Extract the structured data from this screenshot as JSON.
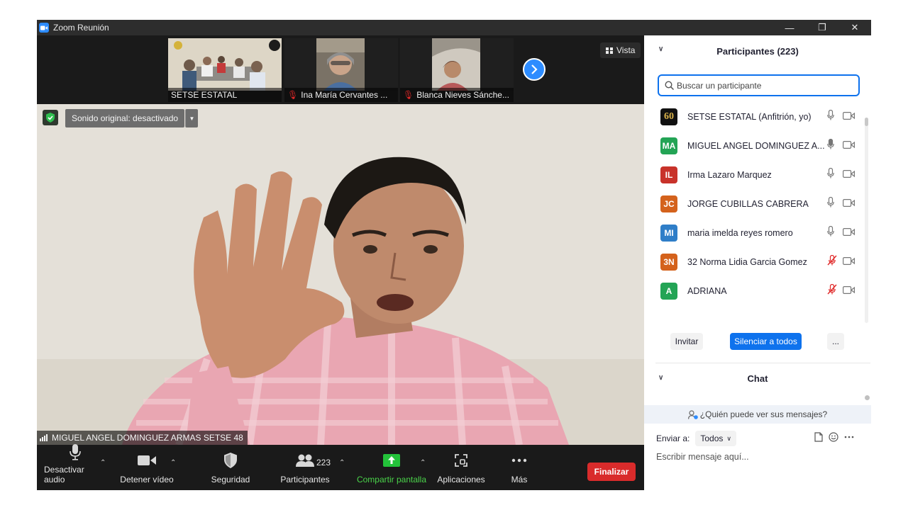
{
  "window": {
    "title": "Zoom Reunión"
  },
  "gallery": {
    "tiles": [
      {
        "name": "SETSE ESTATAL",
        "muted": false
      },
      {
        "name": "Ina María Cervantes ...",
        "muted": true
      },
      {
        "name": "Blanca Nieves Sánche...",
        "muted": true
      }
    ],
    "view_label": "Vista"
  },
  "main_video": {
    "sound_label": "Sonido original: desactivado",
    "speaker_name": "MIGUEL ANGEL DOMINGUEZ ARMAS  SETSE 48"
  },
  "toolbar": {
    "audio_label": "Desactivar audio",
    "video_label": "Detener vídeo",
    "security_label": "Seguridad",
    "participants_label": "Participantes",
    "participants_count": "223",
    "share_label": "Compartir pantalla",
    "apps_label": "Aplicaciones",
    "more_label": "Más",
    "end_label": "Finalizar"
  },
  "participants_panel": {
    "title": "Participantes (223)",
    "search_placeholder": "Buscar un participante",
    "items": [
      {
        "initials": "60",
        "name": "SETSE ESTATAL (Anfitrión, yo)",
        "color": "#1c1c1c",
        "muted": false
      },
      {
        "initials": "MA",
        "name": "MIGUEL ANGEL DOMINGUEZ A...",
        "color": "#23a455",
        "muted": false
      },
      {
        "initials": "IL",
        "name": "Irma Lazaro Marquez",
        "color": "#c8322a",
        "muted": false
      },
      {
        "initials": "JC",
        "name": "JORGE CUBILLAS CABRERA",
        "color": "#d4621c",
        "muted": false
      },
      {
        "initials": "MI",
        "name": "maria imelda reyes romero",
        "color": "#2f7ec8",
        "muted": false
      },
      {
        "initials": "3N",
        "name": "32 Norma Lidia Garcia Gomez",
        "color": "#d4621c",
        "muted": true
      },
      {
        "initials": "A",
        "name": "ADRIANA",
        "color": "#23a455",
        "muted": true
      }
    ],
    "invite_label": "Invitar",
    "mute_all_label": "Silenciar a todos",
    "more_label": "..."
  },
  "chat_panel": {
    "title": "Chat",
    "who_can_see": "¿Quién puede ver sus mensajes?",
    "send_to_label": "Enviar a:",
    "send_to_value": "Todos",
    "input_placeholder": "Escribir mensaje aquí..."
  },
  "colors": {
    "accent": "#0e72ed",
    "end": "#d92b2b",
    "share": "#23c23a",
    "mute": "#e02828"
  }
}
